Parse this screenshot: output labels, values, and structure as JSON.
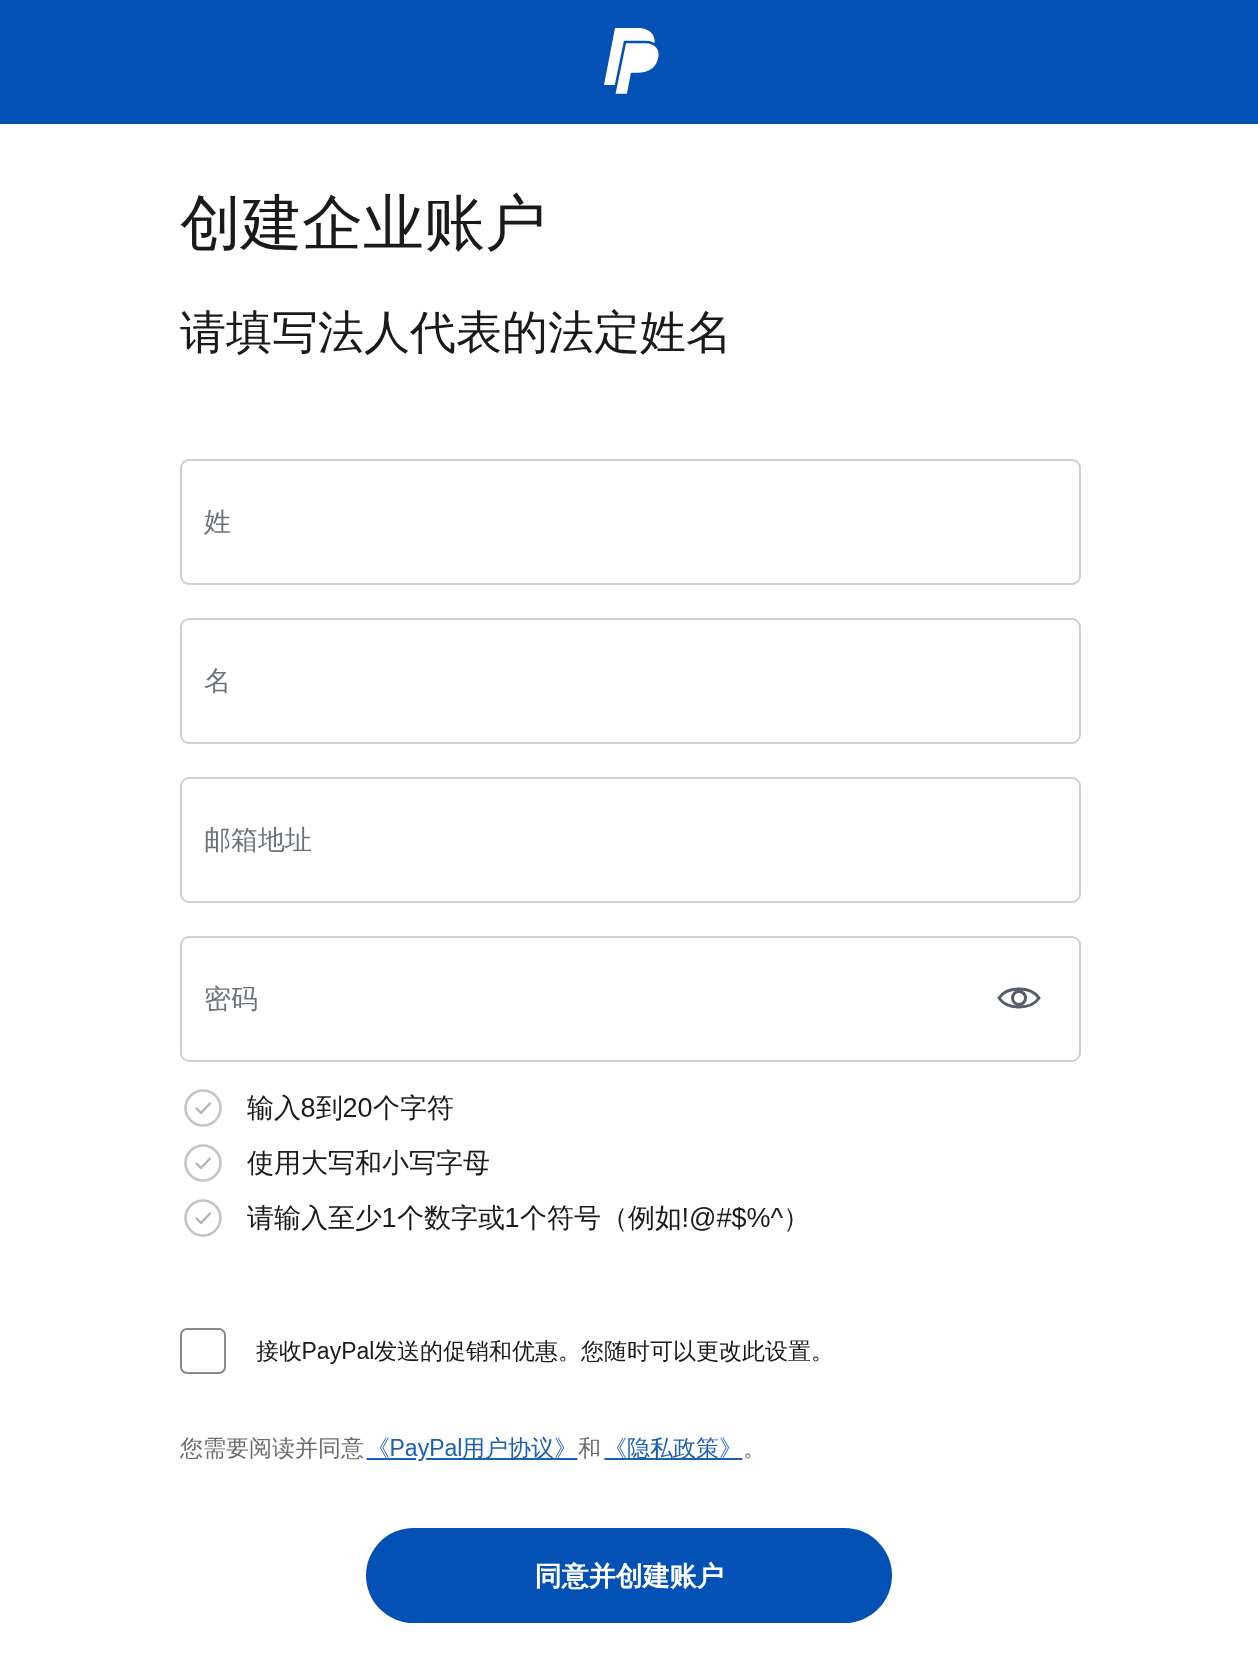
{
  "title": "创建企业账户",
  "subtitle": "请填写法人代表的法定姓名",
  "fields": [
    {
      "kind": "text",
      "placeholder": "姓"
    },
    {
      "kind": "text",
      "placeholder": "名"
    },
    {
      "kind": "text",
      "placeholder": "邮箱地址"
    },
    {
      "kind": "password",
      "placeholder": "密码"
    }
  ],
  "password_rules": [
    {
      "text": "输入8到20个字符",
      "met": false
    },
    {
      "text": "使用大写和小写字母",
      "met": false
    },
    {
      "text": "请输入至少1个数字或1个符号（例如!@#$%^）",
      "met": false
    }
  ],
  "promo_opt_in": {
    "label": "接收PayPal发送的促销和优惠。您随时可以更改此设置。",
    "checked": false
  },
  "consent": [
    {
      "kind": "text",
      "text": "您需要阅读并同意"
    },
    {
      "kind": "link",
      "text": "《PayPal用户协议》"
    },
    {
      "kind": "text",
      "text": "和"
    },
    {
      "kind": "link",
      "text": "《隐私政策》"
    },
    {
      "kind": "text",
      "text": "。"
    }
  ],
  "submit_button": {
    "label": "同意并创建账户"
  }
}
